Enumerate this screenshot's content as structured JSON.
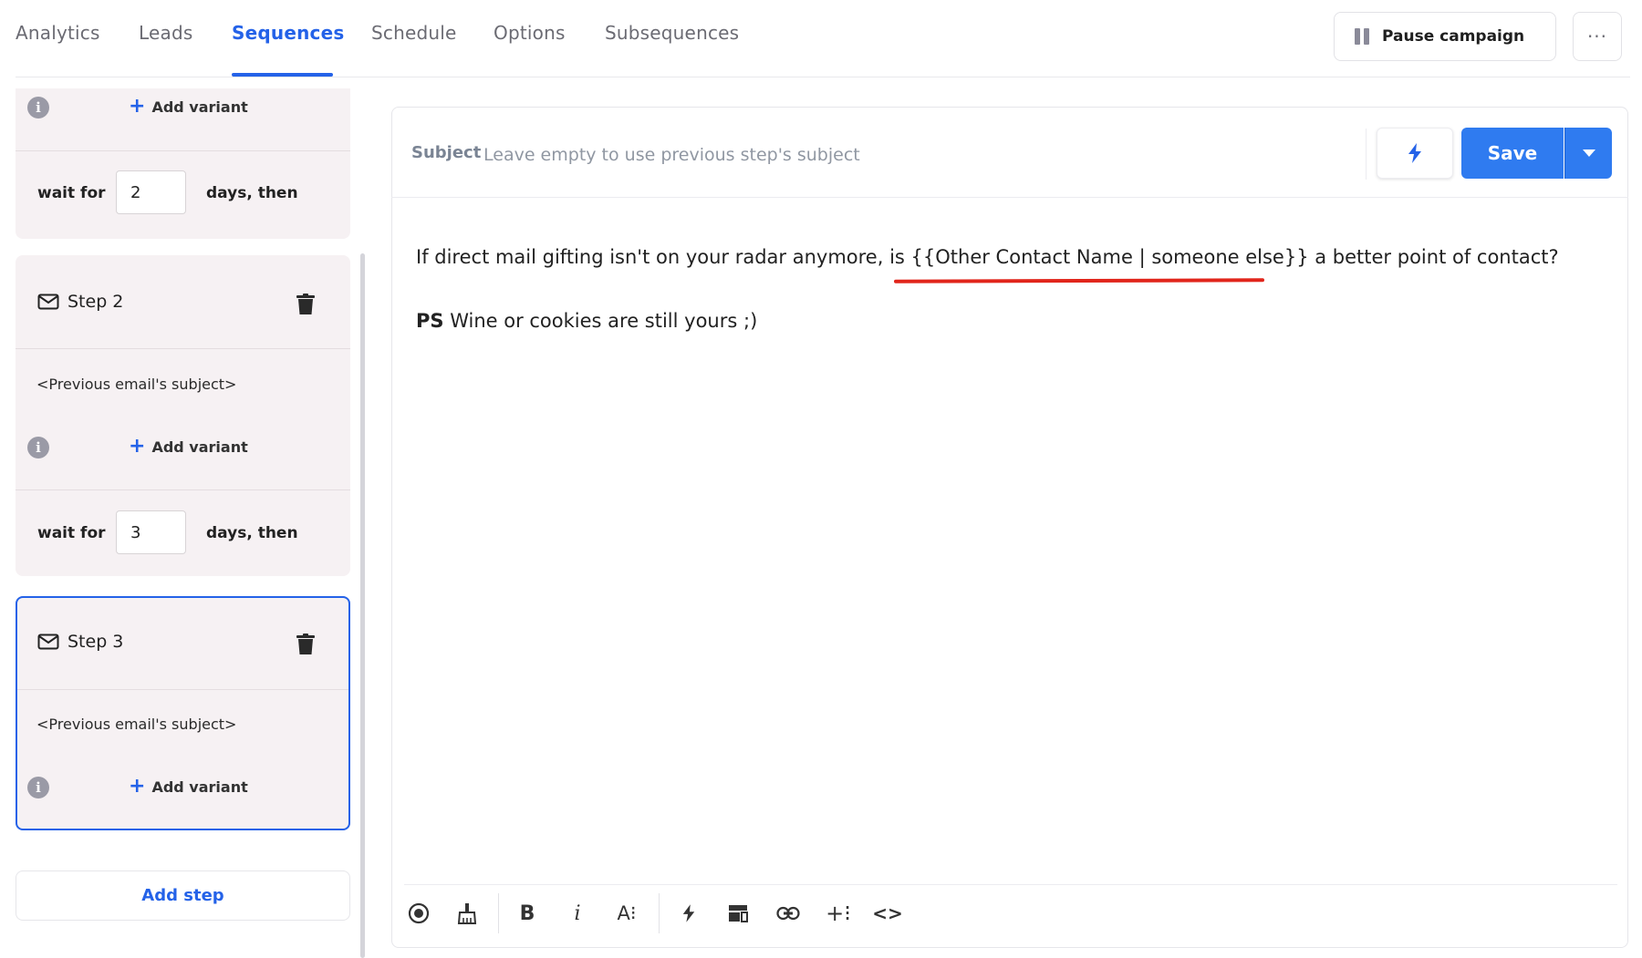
{
  "nav": {
    "tabs": [
      {
        "label": "Analytics"
      },
      {
        "label": "Leads"
      },
      {
        "label": "Sequences"
      },
      {
        "label": "Schedule"
      },
      {
        "label": "Options"
      },
      {
        "label": "Subsequences"
      }
    ],
    "active_tab": "Sequences",
    "pause_label": "Pause campaign",
    "more_label": "···"
  },
  "steps": {
    "step1": {
      "add_variant": "Add variant",
      "wait_label": "wait for",
      "wait_value": "2",
      "wait_suffix": "days, then"
    },
    "step2": {
      "title": "Step 2",
      "subject": "<Previous email's subject>",
      "add_variant": "Add variant",
      "wait_label": "wait for",
      "wait_value": "3",
      "wait_suffix": "days, then"
    },
    "step3": {
      "title": "Step 3",
      "subject": "<Previous email's subject>",
      "add_variant": "Add variant"
    },
    "add_step": "Add step"
  },
  "editor": {
    "subject_label": "Subject",
    "subject_placeholder": "Leave empty to use previous step's subject",
    "save_label": "Save",
    "body_line1_pre": "If direct mail gifting isn't on your radar anymore, is ",
    "body_line1_var": "{{Other Contact Name | someone else}}",
    "body_line1_post": " a better point of contact?",
    "body_line2_bold": "PS",
    "body_line2_rest": " Wine or cookies are still yours ;)"
  },
  "colors": {
    "accent": "#2462e8",
    "save_bg": "#2f7bf0",
    "annotation_underline": "#e1251b",
    "card_bg": "#f6f1f3"
  },
  "toolbar_icons": [
    "preview-icon",
    "clear-format-icon",
    "bold-icon",
    "italic-icon",
    "font-size-icon",
    "variables-icon",
    "template-icon",
    "link-icon",
    "insert-field-icon",
    "code-view-icon"
  ]
}
